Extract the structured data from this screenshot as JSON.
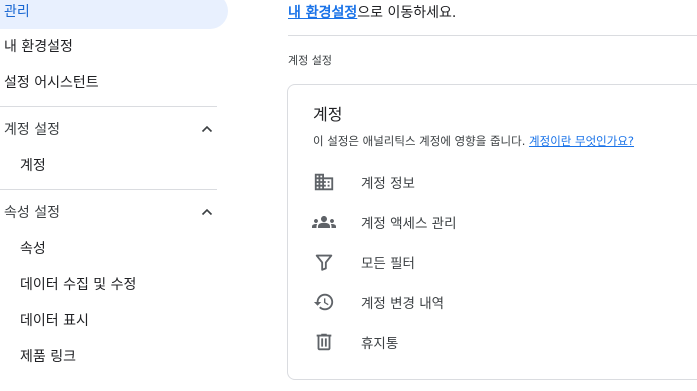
{
  "sidebar": {
    "active_label": "관리",
    "top_items": [
      {
        "label": "내 환경설정"
      },
      {
        "label": "설정 어시스턴트"
      }
    ],
    "account_section": {
      "label": "계정 설정",
      "items": [
        {
          "label": "계정"
        }
      ]
    },
    "property_section": {
      "label": "속성 설정",
      "items": [
        {
          "label": "속성"
        },
        {
          "label": "데이터 수집 및 수정"
        },
        {
          "label": "데이터 표시"
        },
        {
          "label": "제품 링크"
        }
      ]
    }
  },
  "main": {
    "notice_link": "내 환경설정",
    "notice_text": "으로 이동하세요.",
    "section_title": "계정 설정",
    "card": {
      "title": "계정",
      "desc_text": "이 설정은 애널리틱스 계정에 영향을 줍니다.",
      "desc_link": "계정이란 무엇인가요?",
      "rows": [
        {
          "label": "계정 정보",
          "icon": "building-icon"
        },
        {
          "label": "계정 액세스 관리",
          "icon": "people-icon"
        },
        {
          "label": "모든 필터",
          "icon": "filter-icon"
        },
        {
          "label": "계정 변경 내역",
          "icon": "history-icon"
        },
        {
          "label": "휴지통",
          "icon": "trash-icon"
        }
      ]
    }
  },
  "colors": {
    "accent": "#1a73e8",
    "active_bg": "#e8f0fe",
    "icon": "#5f6368",
    "divider": "#dadce0"
  }
}
